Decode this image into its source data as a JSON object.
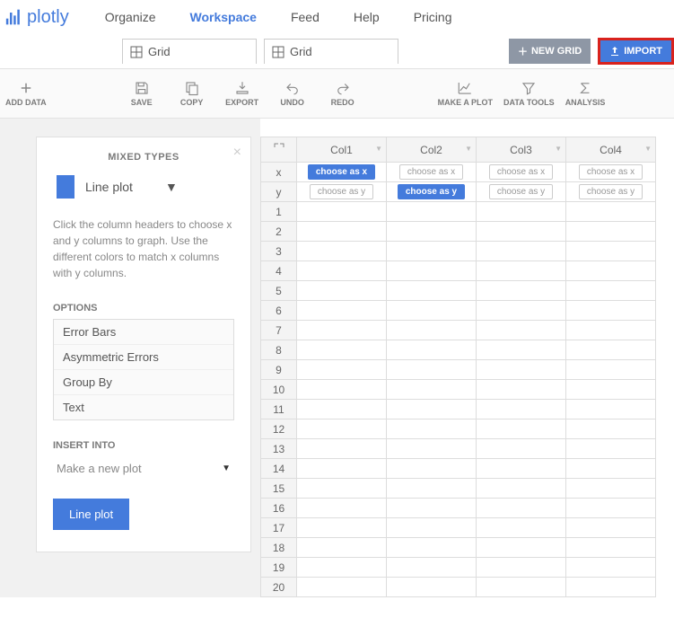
{
  "logo": "plotly",
  "nav": {
    "organize": "Organize",
    "workspace": "Workspace",
    "feed": "Feed",
    "help": "Help",
    "pricing": "Pricing"
  },
  "tabs": {
    "t1": "Grid",
    "t2": "Grid"
  },
  "buttons": {
    "new_grid": "NEW GRID",
    "import": "IMPORT"
  },
  "tools": {
    "add_data": "ADD DATA",
    "save": "SAVE",
    "copy": "COPY",
    "export": "EXPORT",
    "undo": "UNDO",
    "redo": "REDO",
    "make_plot": "MAKE A PLOT",
    "data_tools": "DATA TOOLS",
    "analysis": "ANALYSIS"
  },
  "panel": {
    "title": "MIXED TYPES",
    "plot_type": "Line plot",
    "hint": "Click the column headers to choose x and y columns to graph. Use the different colors to match x columns with y columns.",
    "options_label": "OPTIONS",
    "options": {
      "o1": "Error Bars",
      "o2": "Asymmetric Errors",
      "o3": "Group By",
      "o4": "Text"
    },
    "insert_label": "INSERT INTO",
    "insert_value": "Make a new plot",
    "action": "Line plot"
  },
  "grid": {
    "cols": {
      "c1": "Col1",
      "c2": "Col2",
      "c3": "Col3",
      "c4": "Col4"
    },
    "axis_x": "x",
    "axis_y": "y",
    "choose_x": "choose as x",
    "choose_y": "choose as y",
    "rows": [
      "1",
      "2",
      "3",
      "4",
      "5",
      "6",
      "7",
      "8",
      "9",
      "10",
      "11",
      "12",
      "13",
      "14",
      "15",
      "16",
      "17",
      "18",
      "19",
      "20"
    ]
  }
}
